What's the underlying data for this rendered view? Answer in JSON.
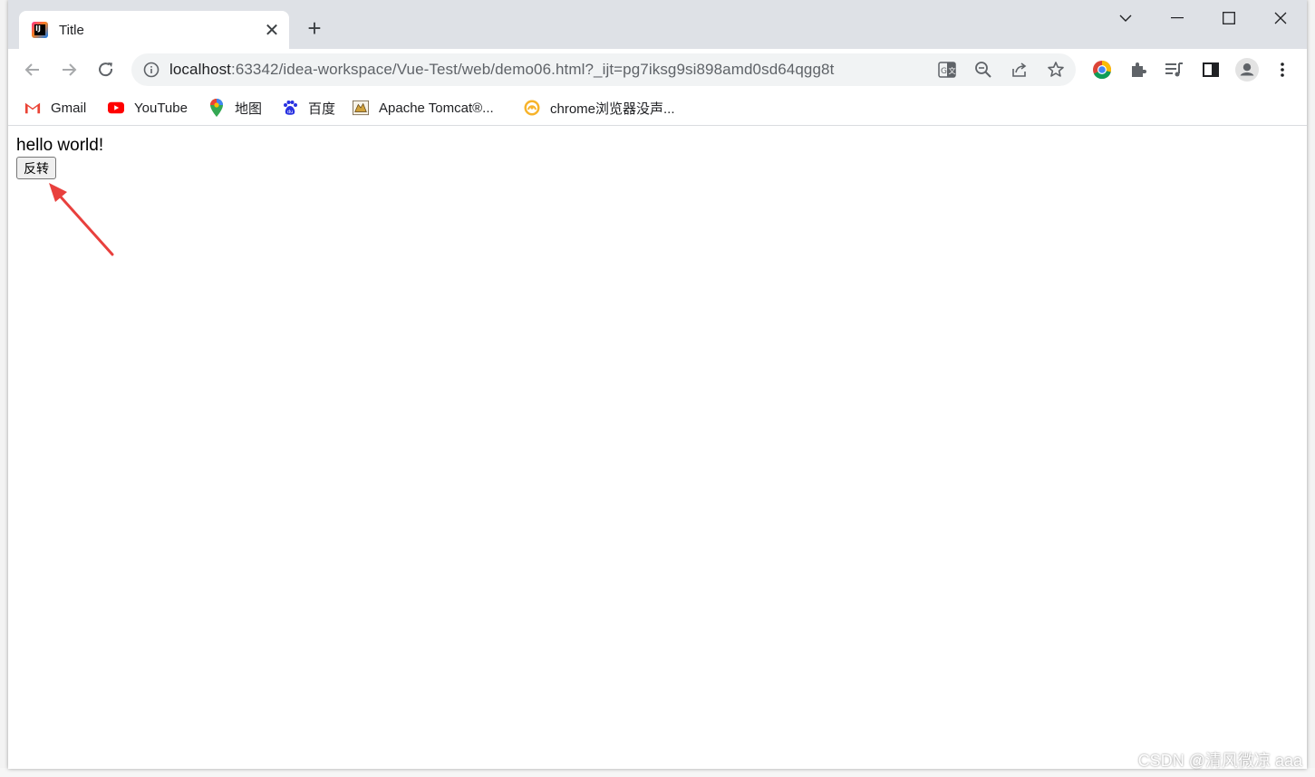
{
  "tab": {
    "title": "Title",
    "close": "✕",
    "favicon_text": "IJ"
  },
  "new_tab": "+",
  "window_controls": [
    "⌵",
    "—",
    "☐",
    "✕"
  ],
  "address_bar": {
    "host": "localhost",
    "path": ":63342/idea-workspace/Vue-Test/web/demo06.html?_ijt=pg7iksg9si898amd0sd64qgg8t"
  },
  "bookmarks": [
    {
      "label": "Gmail",
      "icon": "gmail-icon"
    },
    {
      "label": "YouTube",
      "icon": "youtube-icon"
    },
    {
      "label": "地图",
      "icon": "maps-icon"
    },
    {
      "label": "百度",
      "icon": "baidu-icon"
    },
    {
      "label": "Apache Tomcat®...",
      "icon": "tomcat-icon"
    },
    {
      "label": "chrome浏览器没声...",
      "icon": "chrome-bookmark-icon"
    }
  ],
  "page": {
    "message": "hello world!",
    "button_label": "反转"
  },
  "watermark": "CSDN @清风微凉 aaa",
  "colors": {
    "arrow": "#e8403d",
    "tabstrip": "#dee1e6",
    "omnibox": "#f1f3f4"
  }
}
